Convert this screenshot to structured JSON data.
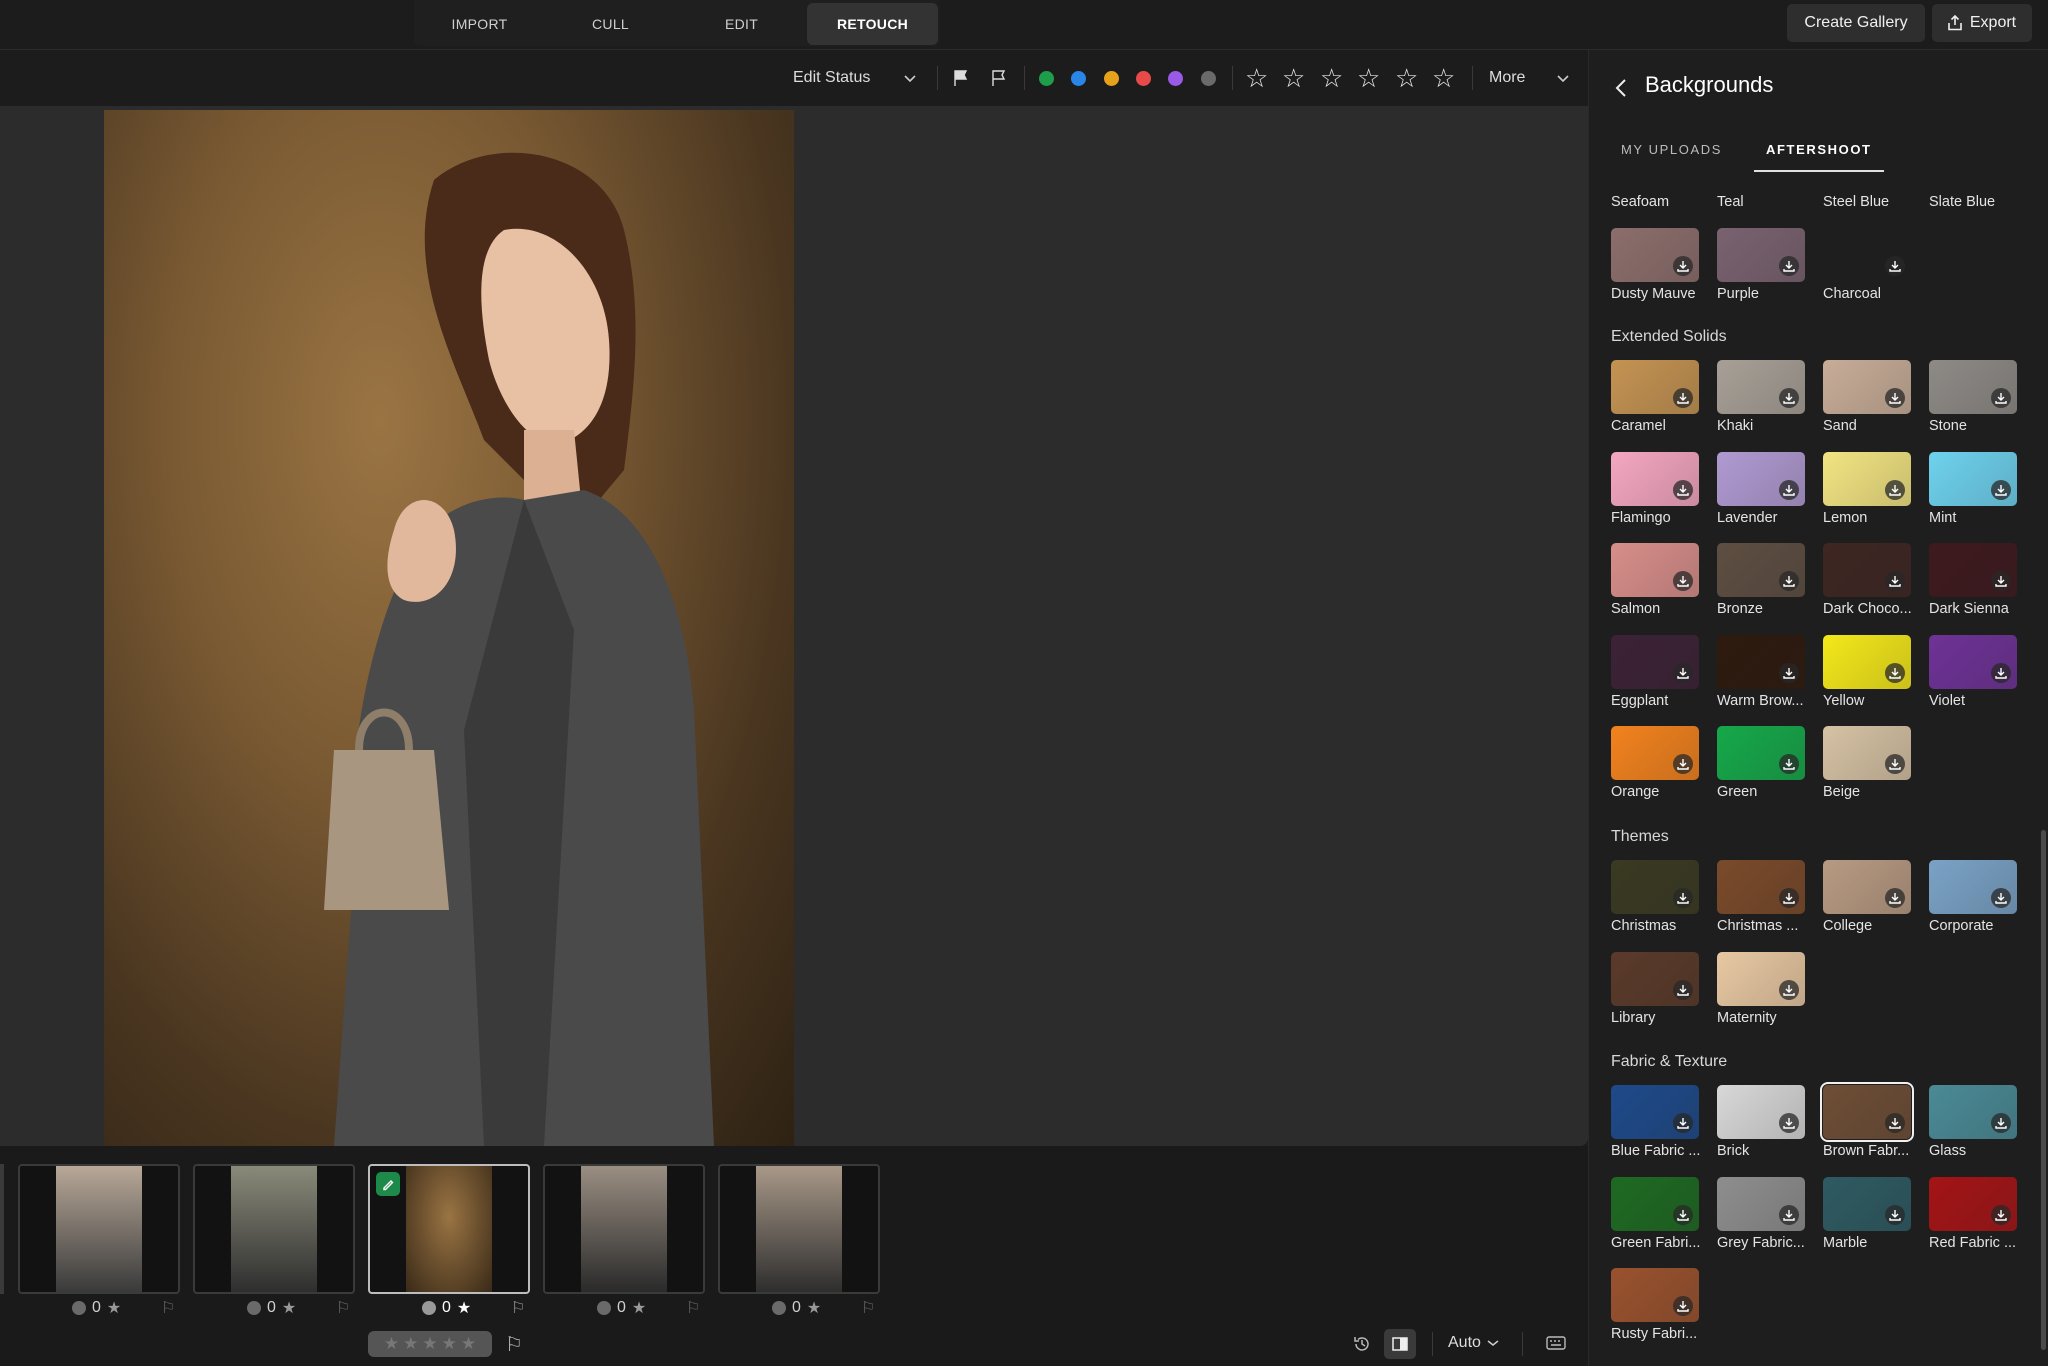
{
  "modes": [
    {
      "label": "IMPORT"
    },
    {
      "label": "CULL"
    },
    {
      "label": "EDIT"
    },
    {
      "label": "RETOUCH",
      "active": true
    }
  ],
  "top_buttons": {
    "create_gallery": "Create Gallery",
    "export": "Export"
  },
  "toolbar": {
    "edit_status": "Edit Status",
    "more": "More",
    "color_labels": [
      "#1e9e4a",
      "#2a86e6",
      "#e6a21a",
      "#e84a4a",
      "#9a5ae6",
      "#6a6a6a"
    ],
    "star_count": 6
  },
  "filmstrip": {
    "items": [
      {
        "rating": "0",
        "selected": false
      },
      {
        "rating": "0",
        "selected": false
      },
      {
        "rating": "0",
        "selected": true,
        "edited": true
      },
      {
        "rating": "0",
        "selected": false
      },
      {
        "rating": "0",
        "selected": false
      }
    ]
  },
  "bottombar": {
    "zoom": "Auto"
  },
  "panel": {
    "title": "Backgrounds",
    "tabs": [
      {
        "label": "MY UPLOADS"
      },
      {
        "label": "AFTERSHOOT",
        "active": true
      }
    ],
    "top_row_labels": [
      "Seafoam",
      "Teal",
      "Steel Blue",
      "Slate Blue"
    ],
    "top_swatches": [
      {
        "label": "Dusty Mauve",
        "color": "#8c6e6c"
      },
      {
        "label": "Purple",
        "color": "#7a6270"
      },
      {
        "label": "Charcoal",
        "color": "#1e1e1e"
      }
    ],
    "sections": [
      {
        "title": "Extended Solids",
        "items": [
          {
            "label": "Caramel",
            "color": "#c49352"
          },
          {
            "label": "Khaki",
            "color": "#a8a097"
          },
          {
            "label": "Sand",
            "color": "#c8ad98"
          },
          {
            "label": "Stone",
            "color": "#8e8a86"
          },
          {
            "label": "Flamingo",
            "color": "#f4a6c0"
          },
          {
            "label": "Lavender",
            "color": "#b09ad2"
          },
          {
            "label": "Lemon",
            "color": "#f2e482"
          },
          {
            "label": "Mint",
            "color": "#6ed2ee"
          },
          {
            "label": "Salmon",
            "color": "#d88e8a"
          },
          {
            "label": "Bronze",
            "color": "#5e4e42"
          },
          {
            "label": "Dark Choco...",
            "color": "#3e2622"
          },
          {
            "label": "Dark Sienna",
            "color": "#3e1a1e"
          },
          {
            "label": "Eggplant",
            "color": "#3c2236"
          },
          {
            "label": "Warm Brow...",
            "color": "#2e1a0e"
          },
          {
            "label": "Yellow",
            "color": "#f4e81a"
          },
          {
            "label": "Violet",
            "color": "#6e3296"
          },
          {
            "label": "Orange",
            "color": "#f2821e"
          },
          {
            "label": "Green",
            "color": "#16a84a"
          },
          {
            "label": "Beige",
            "color": "#d6c2a4"
          }
        ]
      },
      {
        "title": "Themes",
        "items": [
          {
            "label": "Christmas",
            "color": "#3a3a22"
          },
          {
            "label": "Christmas ...",
            "color": "#7a4a2a"
          },
          {
            "label": "College",
            "color": "#b89a82"
          },
          {
            "label": "Corporate",
            "color": "#7aa2c6"
          },
          {
            "label": "Library",
            "color": "#5a3a2a"
          },
          {
            "label": "Maternity",
            "color": "#e8c8a2"
          }
        ]
      },
      {
        "title": "Fabric & Texture",
        "items": [
          {
            "label": "Blue Fabric ...",
            "color": "#1e4a8a"
          },
          {
            "label": "Brick",
            "color": "#d8d8d8"
          },
          {
            "label": "Brown Fabr...",
            "color": "#6e4e36",
            "selected": true
          },
          {
            "label": "Glass",
            "color": "#4a8a96"
          },
          {
            "label": "Green Fabri...",
            "color": "#1e6a22"
          },
          {
            "label": "Grey Fabric...",
            "color": "#8e8e8e"
          },
          {
            "label": "Marble",
            "color": "#2e5a62"
          },
          {
            "label": "Red Fabric ...",
            "color": "#a41416"
          },
          {
            "label": "Rusty Fabri...",
            "color": "#9a522e"
          }
        ]
      }
    ]
  }
}
